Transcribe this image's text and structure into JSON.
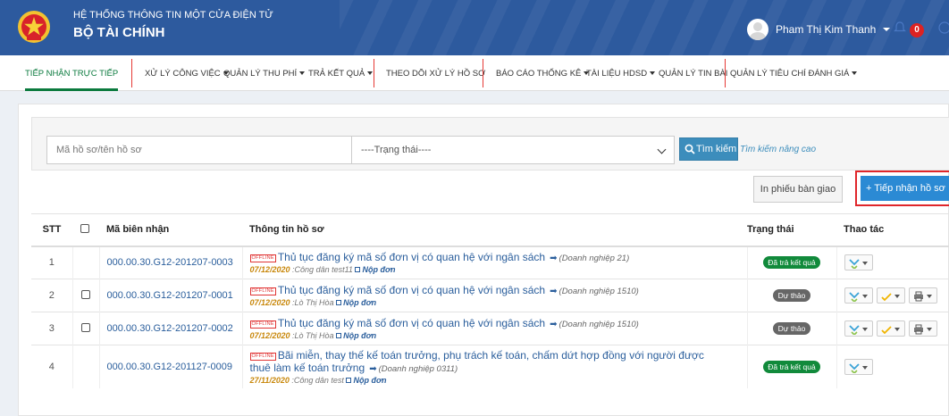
{
  "header": {
    "system_title": "HỆ THỐNG THÔNG TIN MỘT CỬA ĐIỆN TỬ",
    "org_title": "BỘ TÀI CHÍNH",
    "user_name": "Pham Thị Kim Thanh",
    "notification_count": "0"
  },
  "nav": {
    "items": [
      {
        "label": "TIẾP NHẬN TRỰC TIẾP"
      },
      {
        "label": "XỬ LÝ CÔNG VIỆC"
      },
      {
        "label": "QUẢN LÝ THU PHÍ"
      },
      {
        "label": "TRẢ KẾT QUẢ"
      },
      {
        "label": "THEO DÕI XỬ LÝ HỒ SƠ"
      },
      {
        "label": "BÁO CÁO THỐNG KÊ"
      },
      {
        "label": "TÀI LIỆU HDSD"
      },
      {
        "label": "QUẢN LÝ TIN BÀI"
      },
      {
        "label": "QUẢN LÝ TIÊU CHÍ ĐÁNH GIÁ"
      }
    ]
  },
  "search": {
    "keyword_placeholder": "Mã hồ sơ/tên hồ sơ",
    "status_selected": "----Trạng thái----",
    "search_label": "Tìm kiếm",
    "advanced_label": "Tìm kiếm nâng cao"
  },
  "actions": {
    "print_label": "In phiếu bàn giao",
    "receive_label": "+ Tiếp nhận hồ sơ"
  },
  "table": {
    "headers": {
      "stt": "STT",
      "code": "Mã biên nhận",
      "info": "Thông tin hồ sơ",
      "status": "Trạng thái",
      "actions": "Thao tác"
    },
    "offline_tag": "OFFLINE",
    "submit_label": "Nộp đơn",
    "rows": [
      {
        "stt": "1",
        "code": "000.00.30.G12-201207-0003",
        "procedure": "Thủ tục đăng ký mã số đơn vị có quan hệ với ngân sách",
        "business": "(Doanh nghiệp 21)",
        "date": "07/12/2020",
        "submitter": " :Công dân test11",
        "status": "Đã trả kết quả"
      },
      {
        "stt": "2",
        "code": "000.00.30.G12-201207-0001",
        "procedure": "Thủ tục đăng ký mã số đơn vị có quan hệ với ngân sách",
        "business": "(Doanh nghiệp 1510)",
        "date": "07/12/2020",
        "submitter": " :Lò Thị Hòa",
        "status": "Dự thảo"
      },
      {
        "stt": "3",
        "code": "000.00.30.G12-201207-0002",
        "procedure": "Thủ tục đăng ký mã số đơn vị có quan hệ với ngân sách",
        "business": "(Doanh nghiệp 1510)",
        "date": "07/12/2020",
        "submitter": " :Lò Thị Hòa",
        "status": "Dự thảo"
      },
      {
        "stt": "4",
        "code": "000.00.30.G12-201127-0009",
        "procedure_line1": "Bãi miễn, thay thế kế toán trưởng, phụ trách kế toán, chấm dứt hợp đồng với người được",
        "procedure_line2": "thuê làm kế toán trưởng",
        "business": "(Doanh nghiệp 0311)",
        "date": "27/11/2020",
        "submitter": " :Công dân test",
        "status": "Đã trả kết quả"
      }
    ]
  },
  "colors": {
    "header_bg": "#2d5a9e",
    "active_nav": "#0b7a3e",
    "primary": "#3c8dbc",
    "done_badge": "#118a3b",
    "draft_badge": "#666666",
    "highlight_border": "#e0262b"
  }
}
